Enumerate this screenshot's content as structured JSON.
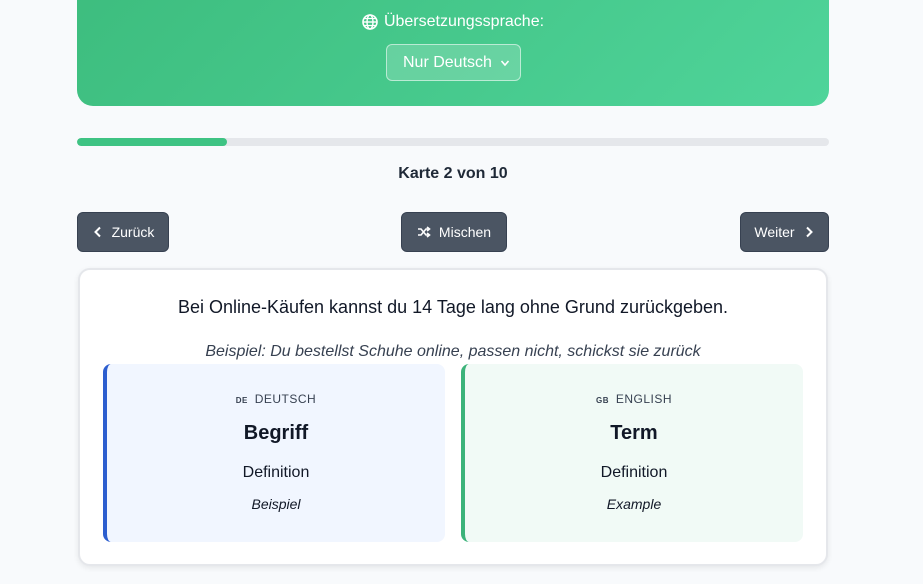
{
  "language_panel": {
    "label": "Übersetzungssprache:",
    "selected": "Nur Deutsch"
  },
  "progress": {
    "current": 2,
    "total": 10,
    "fraction": 0.2
  },
  "counter_text": "Karte 2 von 10",
  "buttons": {
    "prev": "Zurück",
    "shuffle": "Mischen",
    "next": "Weiter"
  },
  "card": {
    "sentence": "Bei Online-Käufen kannst du 14 Tage lang ohne Grund zurückgeben.",
    "example": "Beispiel: Du bestellst Schuhe online, passen nicht, schickst sie zurück",
    "panels": [
      {
        "flag": "DE",
        "language": "DEUTSCH",
        "term": "Begriff",
        "definition": "Definition",
        "example": "Beispiel"
      },
      {
        "flag": "GB",
        "language": "ENGLISH",
        "term": "Term",
        "definition": "Definition",
        "example": "Example"
      }
    ]
  },
  "colors": {
    "accent_green": "#3ec383",
    "button_gray": "#4b5563",
    "german_border": "#2c5ecf",
    "english_border": "#3cb37a"
  }
}
